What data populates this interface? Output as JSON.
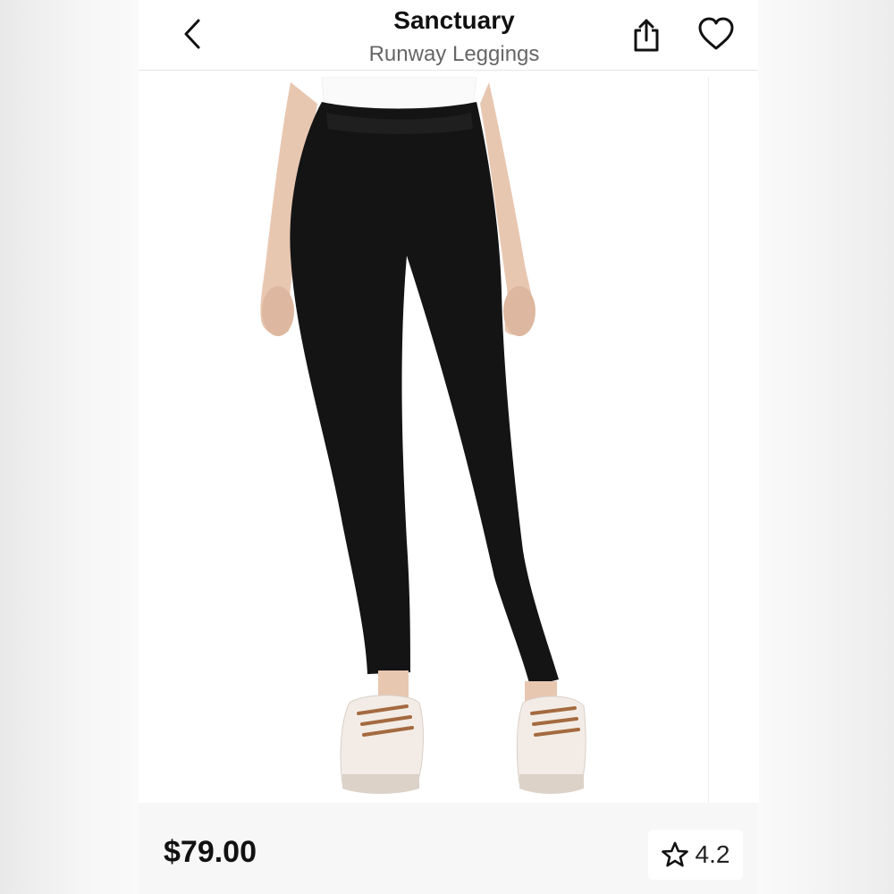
{
  "header": {
    "brand": "Sanctuary",
    "product_name": "Runway Leggings",
    "back_icon": "chevron-left-icon",
    "share_icon": "share-icon",
    "favorite_icon": "heart-outline-icon"
  },
  "product": {
    "image_description": "Model wearing black pull-on leggings with white sneakers",
    "price": "$79.00",
    "rating": "4.2",
    "rating_icon": "star-outline-icon"
  },
  "colors": {
    "text_primary": "#111111",
    "text_secondary": "#666666",
    "background": "#ffffff",
    "leggings": "#141414"
  }
}
